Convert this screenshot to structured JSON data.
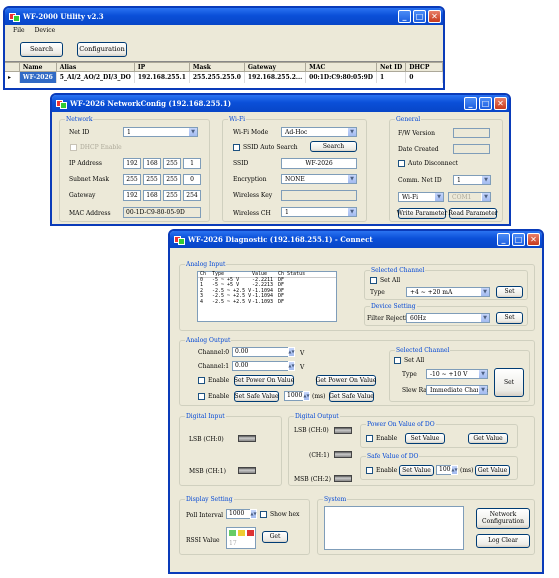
{
  "utility": {
    "title": "WF-2000 Utility  v2.3",
    "menu": [
      "File",
      "Device"
    ],
    "search_btn": "Search",
    "config_btn": "Configuration",
    "columns": [
      "Name",
      "Alias",
      "IP",
      "Mask",
      "Gateway",
      "MAC",
      "Net ID",
      "DHCP"
    ],
    "row": [
      "WF-2026",
      "5_AI/2_AO/2_DI/3_DO",
      "192.168.255.1",
      "255.255.255.0",
      "192.168.255.2...",
      "00:1D:C9:80:05:9D",
      "1",
      "0"
    ]
  },
  "netconfig": {
    "title": "WF-2026 NetworkConfig (192.168.255.1)",
    "network": {
      "label": "Network",
      "net_id_label": "Net ID",
      "net_id": "1",
      "dhcp": "DHCP Enable",
      "ip_label": "IP Address",
      "ip": [
        "192",
        "168",
        "255",
        "1"
      ],
      "mask_label": "Subnet Mask",
      "mask": [
        "255",
        "255",
        "255",
        "0"
      ],
      "gw_label": "Gateway",
      "gw": [
        "192",
        "168",
        "255",
        "254"
      ],
      "mac_label": "MAC Address",
      "mac": "00-1D-C9-80-05-9D"
    },
    "wifi": {
      "label": "Wi-Fi",
      "mode_label": "Wi-Fi Mode",
      "mode": "Ad-Hoc",
      "ssid_auto": "SSID Auto Search",
      "search_btn": "Search",
      "ssid_label": "SSID",
      "ssid": "WF-2026",
      "enc_label": "Encryption",
      "enc": "NONE",
      "key_label": "Wireless Key",
      "ch_label": "Wireless CH",
      "ch": "1"
    },
    "general": {
      "label": "General",
      "fw": "F/W Version",
      "date": "Date Created",
      "auto": "Auto Disconnect",
      "comm_label": "Comm. Net ID",
      "comm": "1",
      "port_sel": "Wi-Fi",
      "port_val": "COM1",
      "write_btn": "Write Parameter",
      "read_btn": "Read Parameter"
    }
  },
  "diag": {
    "title": "WF-2026 Diagnostic (192.168.255.1) - Connect",
    "ai": {
      "label": "Analog Input",
      "cols": [
        "Ch",
        "Type",
        "Value",
        "Ch Status"
      ],
      "rows": [
        [
          "0",
          "-5 ~ +5 V",
          "-2.2211",
          "DF"
        ],
        [
          "1",
          "-5 ~ +5 V",
          "-2.2213",
          "DF"
        ],
        [
          "2",
          "-2.5 ~ +2.5 V",
          "-1.1094",
          "DF"
        ],
        [
          "3",
          "-2.5 ~ +2.5 V",
          "-1.1094",
          "DF"
        ],
        [
          "4",
          "-2.5 ~ +2.5 V",
          "-1.1093",
          "DF"
        ]
      ],
      "sel_label": "Selected Channel",
      "set_all": "Set All",
      "type_label": "Type",
      "type": "+4 ~ +20 mA",
      "set_btn": "Set",
      "dev_label": "Device Setting",
      "filter_label": "Filter Rejection",
      "filter": "60Hz",
      "set_btn2": "Set"
    },
    "ao": {
      "label": "Analog Output",
      "ch0_label": "Channel:0",
      "ch0": "0.00",
      "ch1_label": "Channel:1",
      "ch1": "0.00",
      "unit": "V",
      "enable": "Enable",
      "set_pov": "Set Power On Value",
      "get_pov": "Get Power On Value",
      "enable2": "Enable",
      "set_safe": "Set Safe Value",
      "safe_val": "1000",
      "ms": "(ms)",
      "get_safe": "Get Safe Value",
      "sel_label": "Selected Channel",
      "set_all": "Set All",
      "type_label": "Type",
      "type": "-10 ~ +10 V",
      "slew_label": "Slew Rate",
      "slew": "Immediate Change",
      "set_btn": "Set"
    },
    "di": {
      "label": "Digital Input",
      "lsb": "LSB (CH:0)",
      "msb": "MSB (CH:1)"
    },
    "do": {
      "label": "Digital Output",
      "lsb": "LSB (CH:0)",
      "ch1": "(CH:1)",
      "msb": "MSB (CH:2)",
      "pov_label": "Power On Value of DO",
      "enable": "Enable",
      "set_val": "Set Value",
      "get_val": "Get Value",
      "safe_label": "Safe Value of DO",
      "enable2": "Enable",
      "set_val2": "Set Value",
      "safe": "1000",
      "ms": "(ms)",
      "get_val2": "Get Value"
    },
    "display": {
      "label": "Display Setting",
      "poll_label": "Poll Interval",
      "poll": "1000",
      "show_hex": "Show hex",
      "rssi_label": "RSSI Value",
      "rssi": "17",
      "get_btn": "Get"
    },
    "system": {
      "label": "System",
      "net_btn_1": "Network",
      "net_btn_2": "Configuration",
      "log_btn": "Log Clear"
    }
  }
}
